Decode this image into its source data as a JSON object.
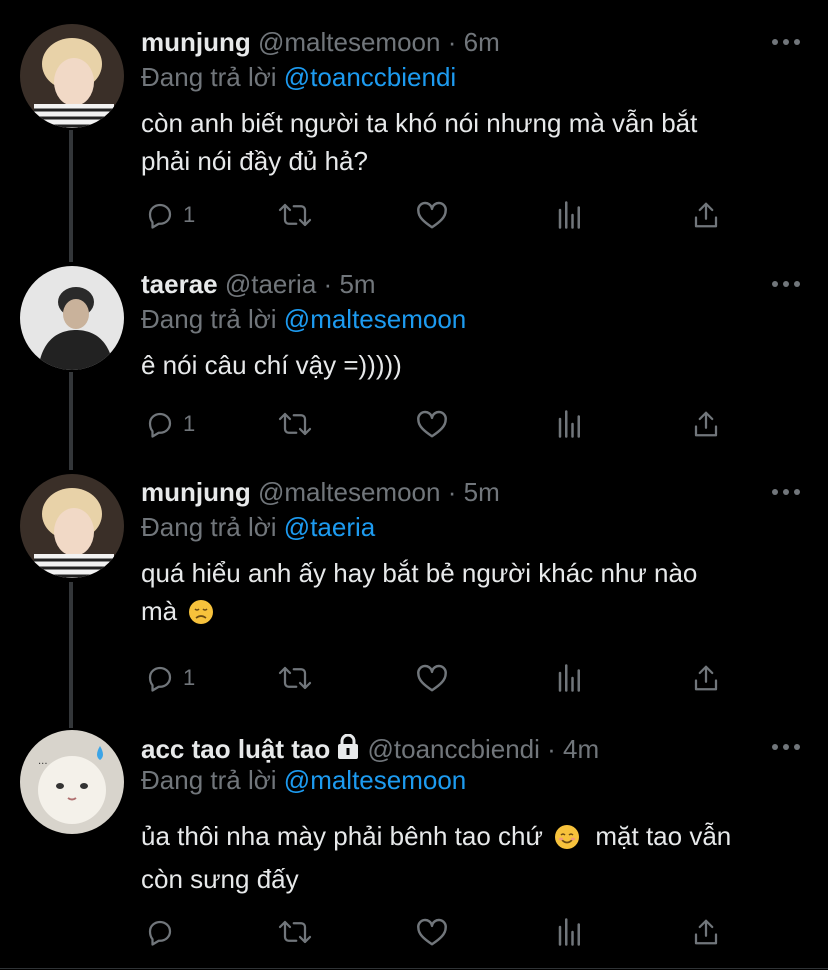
{
  "reply_label": "Đang trả lời",
  "colors": {
    "background": "#000000",
    "text": "#e7e9ea",
    "muted": "#71767b",
    "link": "#1d9bf0"
  },
  "tweets": [
    {
      "name": "munjung",
      "handle": "@maltesemoon",
      "dot": "·",
      "time": "6m",
      "replying_to": "@toanccbiendi",
      "text_lines": [
        "còn anh biết người ta khó nói nhưng mà vẫn bắt",
        "phải nói đầy đủ hả?"
      ],
      "reply_count": "1"
    },
    {
      "name": "taerae",
      "handle": "@taeria",
      "dot": "·",
      "time": "5m",
      "replying_to": "@maltesemoon",
      "text_lines": [
        "ê nói câu chí vậy =)))))"
      ],
      "reply_count": "1"
    },
    {
      "name": "munjung",
      "handle": "@maltesemoon",
      "dot": "·",
      "time": "5m",
      "replying_to": "@taeria",
      "text_lines": [
        "quá hiểu anh ấy hay bắt bẻ người khác như nào",
        "mà"
      ],
      "emoji": "disappointed-face-emoji",
      "reply_count": "1"
    },
    {
      "name": "acc tao luật tao",
      "name_icon": "lock-icon",
      "handle": "@toanccbiendi",
      "dot": "·",
      "time": "4m",
      "replying_to": "@maltesemoon",
      "text_line1_a": "ủa thôi nha mày phải bênh tao chứ",
      "text_line1_emoji": "smiling-face-emoji",
      "text_line1_b": "mặt tao vẫn",
      "text_line2": "còn sưng đấy",
      "reply_count": ""
    }
  ],
  "icons": [
    "reply-icon",
    "retweet-icon",
    "like-icon",
    "analytics-icon",
    "share-icon",
    "more-icon"
  ]
}
